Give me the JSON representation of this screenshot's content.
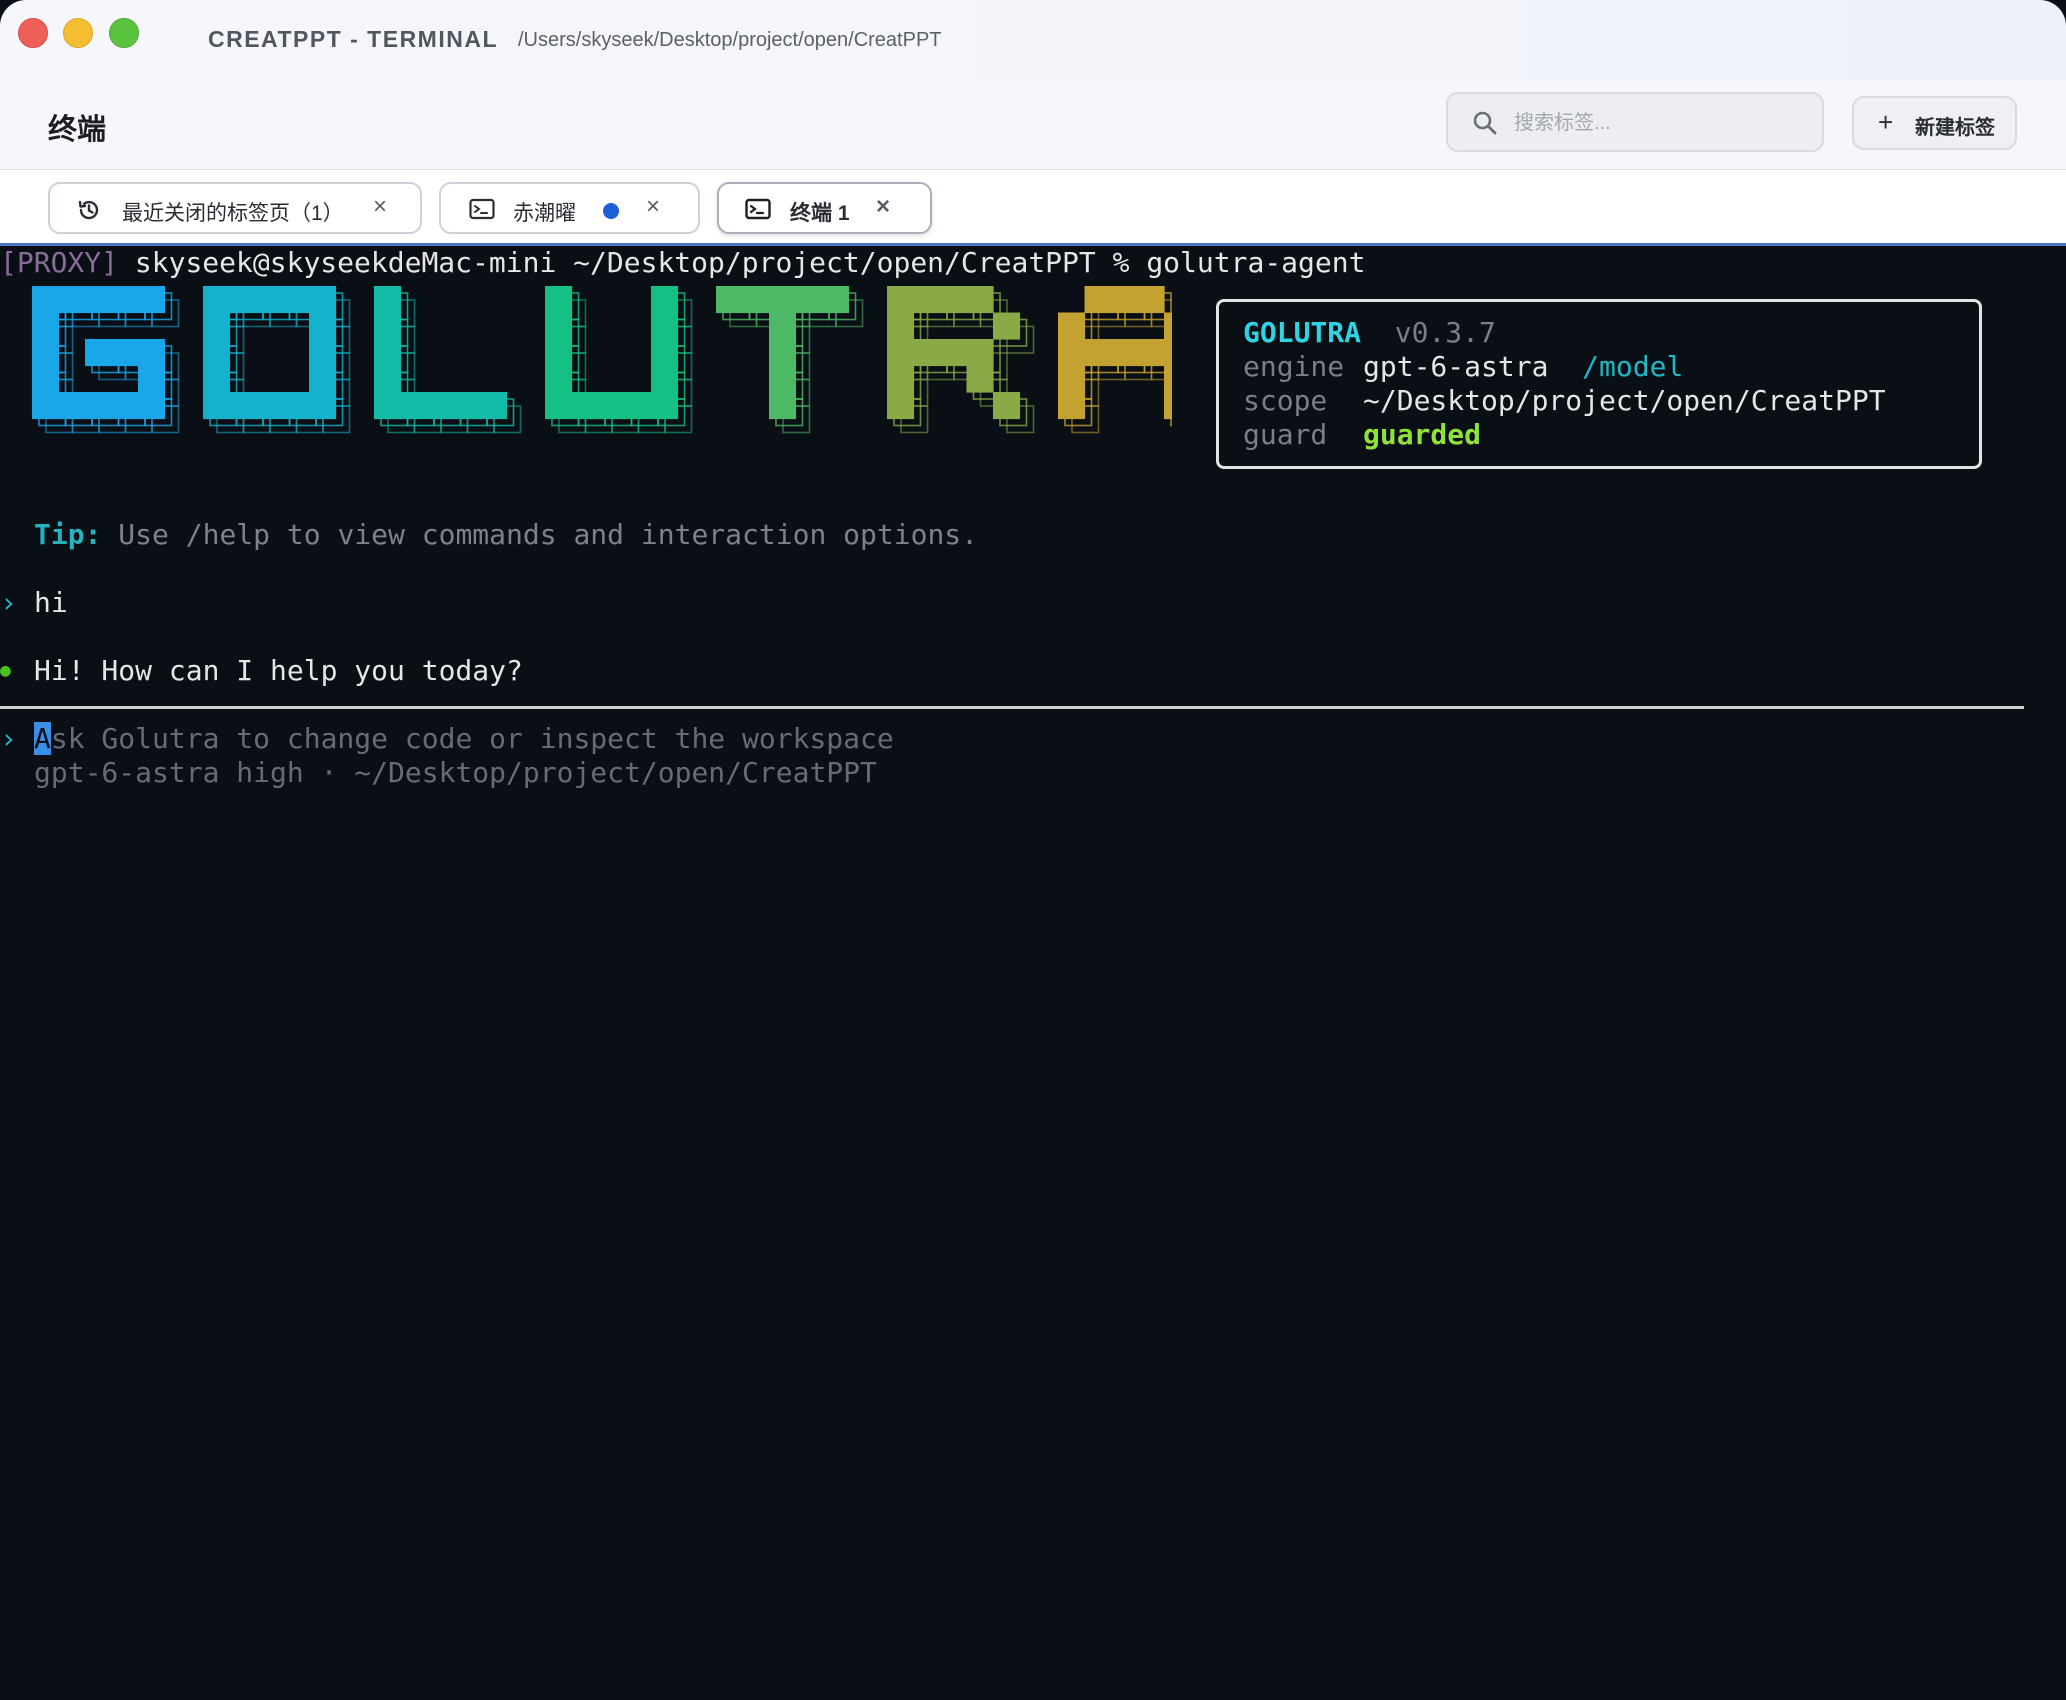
{
  "window": {
    "app_title": "CREATPPT - TERMINAL",
    "path": "/Users/skyseek/Desktop/project/open/CreatPPT"
  },
  "header": {
    "title": "终端",
    "search_placeholder": "搜索标签...",
    "new_tab_label": "新建标签"
  },
  "tabs": [
    {
      "label": "最近关闭的标签页（1）",
      "icon": "history-icon",
      "close": "×"
    },
    {
      "label": "赤潮曜",
      "icon": "terminal-icon",
      "close": "×",
      "status_color": "#1c5fd6"
    },
    {
      "label": "终端 1",
      "icon": "terminal-icon",
      "close": "×",
      "active": true
    }
  ],
  "terminal": {
    "prompt_tag": "[PROXY]",
    "prompt_text": " skyseek@skyseekdeMac-mini ~/Desktop/project/open/CreatPPT % golutra-agent",
    "banner_text": "GOLUTRA",
    "banner_colors": [
      "#1aa7ea",
      "#14b2cc",
      "#12bca8",
      "#14c084",
      "#4db865",
      "#8aaa48",
      "#c4a232",
      "#e9a11e"
    ],
    "info": {
      "brand": "GOLUTRA",
      "version": "v0.3.7",
      "engine_key": "engine",
      "engine_value": "gpt-6-astra",
      "engine_cmd": "/model",
      "scope_key": "scope",
      "scope_value": "~/Desktop/project/open/CreatPPT",
      "guard_key": "guard",
      "guard_value": "guarded"
    },
    "tip_label": "Tip:",
    "tip_text": " Use /help to view commands and interaction options.",
    "prompt_chevron": "›",
    "user_message": "hi",
    "reply_bullet": "●",
    "assistant_message": "Hi! How can I help you today?",
    "input_cursor_char": "A",
    "input_placeholder_rest": "sk Golutra to change code or inspect the workspace",
    "status_line": "gpt-6-astra high · ~/Desktop/project/open/CreatPPT"
  }
}
